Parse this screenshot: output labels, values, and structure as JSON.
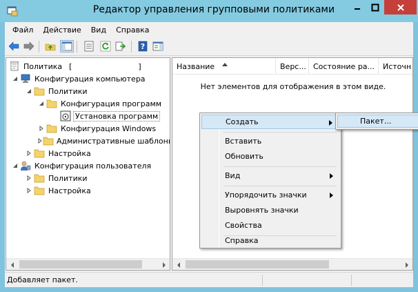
{
  "window": {
    "title": "Редактор управления групповыми политиками",
    "accent": "#84cae1",
    "close_color": "#c6403a"
  },
  "menu": [
    "Файл",
    "Действие",
    "Вид",
    "Справка"
  ],
  "toolbar_icons": [
    "back-arrow-icon",
    "forward-arrow-icon",
    "up-folder-icon",
    "show-hide-tree-icon",
    "export-list-icon",
    "refresh-icon",
    "export-icon",
    "help-icon",
    "action-pane-icon"
  ],
  "tree": {
    "root": "Политика",
    "root_bracket": "[",
    "root_bracket_close": "]",
    "computer_config": "Конфигурация компьютера",
    "policies": "Политики",
    "software_config": "Конфигурация программ",
    "software_install": "Установка программ",
    "windows_config": "Конфигурация Windows",
    "admin_templates": "Административные шаблоны",
    "settings": "Настройка",
    "user_config": "Конфигурация пользователя",
    "user_policies": "Политики",
    "user_settings": "Настройка"
  },
  "list": {
    "columns": [
      "Название",
      "Верс...",
      "Состояние ра...",
      "Источн"
    ],
    "empty_message": "Нет элементов для отображения в этом виде."
  },
  "context_menu": {
    "create": "Создать",
    "paste": "Вставить",
    "refresh": "Обновить",
    "view": "Вид",
    "arrange": "Упорядочить значки",
    "align": "Выровнять значки",
    "properties": "Свойства",
    "help": "Справка"
  },
  "submenu": {
    "package": "Пакет..."
  },
  "status": {
    "text": "Добавляет пакет."
  }
}
